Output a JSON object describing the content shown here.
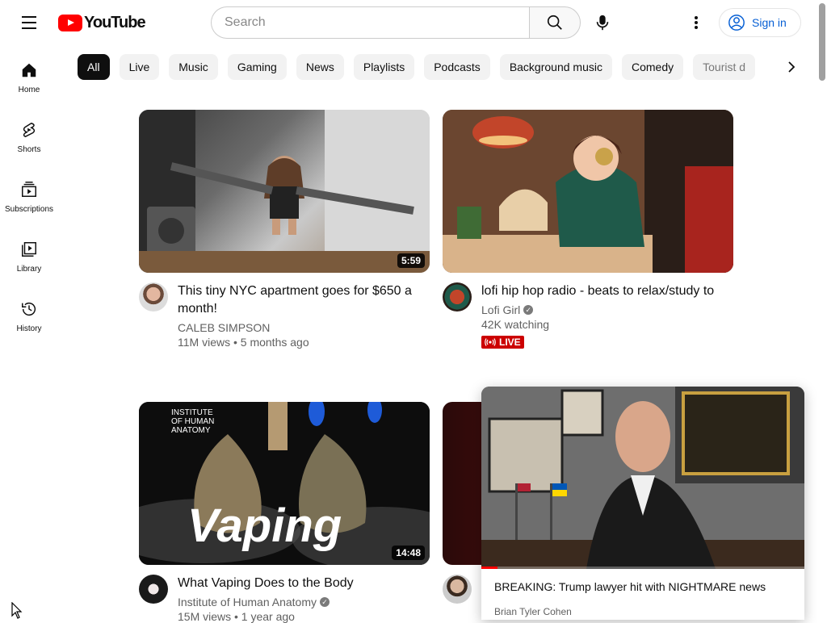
{
  "header": {
    "logo_text": "YouTube",
    "search_placeholder": "Search",
    "signin_label": "Sign in"
  },
  "sidebar": {
    "items": [
      {
        "label": "Home",
        "icon": "home-icon"
      },
      {
        "label": "Shorts",
        "icon": "shorts-icon"
      },
      {
        "label": "Subscriptions",
        "icon": "subscriptions-icon"
      },
      {
        "label": "Library",
        "icon": "library-icon"
      },
      {
        "label": "History",
        "icon": "history-icon"
      }
    ]
  },
  "chips": [
    "All",
    "Live",
    "Music",
    "Gaming",
    "News",
    "Playlists",
    "Podcasts",
    "Background music",
    "Comedy",
    "Tourist d"
  ],
  "videos": [
    {
      "title": "This tiny NYC apartment goes for $650 a month!",
      "channel": "CALEB SIMPSON",
      "stats": "11M views • 5 months ago",
      "duration": "5:59"
    },
    {
      "title": "lofi hip hop radio - beats to relax/study to",
      "channel": "Lofi Girl",
      "stats": "42K watching",
      "live_label": "LIVE"
    },
    {
      "title": "What Vaping Does to the Body",
      "channel": "Institute of Human Anatomy",
      "stats": "15M views • 1 year ago",
      "duration": "14:48",
      "thumb_text": "Vaping",
      "thumb_brand": "INSTITUTE OF HUMAN ANATOMY"
    }
  ],
  "miniplayer": {
    "title": "BREAKING: Trump lawyer hit with NIGHTMARE news",
    "channel": "Brian Tyler Cohen",
    "progress": 0.05
  },
  "colors": {
    "brand_red": "#ff0000",
    "link_blue": "#065fd4",
    "live_red": "#cc0000"
  }
}
